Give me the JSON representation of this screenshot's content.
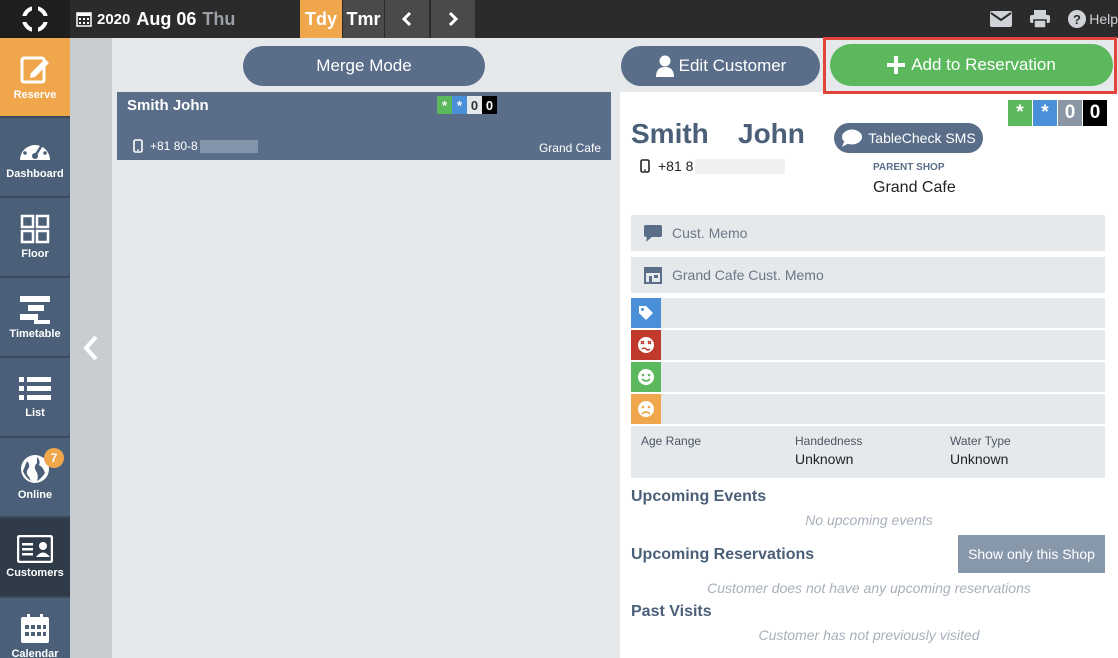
{
  "header": {
    "year": "2020",
    "month_day": "Aug 06",
    "weekday": "Thu",
    "today_label": "Tdy",
    "tomorrow_label": "Tmr",
    "help_label": "Help"
  },
  "sidebar": {
    "items": [
      {
        "label": "Reserve",
        "icon": "edit-icon"
      },
      {
        "label": "Dashboard",
        "icon": "dashboard-icon"
      },
      {
        "label": "Floor",
        "icon": "floor-icon"
      },
      {
        "label": "Timetable",
        "icon": "timetable-icon"
      },
      {
        "label": "List",
        "icon": "list-icon"
      },
      {
        "label": "Online",
        "icon": "globe-icon",
        "badge": "7"
      },
      {
        "label": "Customers",
        "icon": "customer-card-icon"
      },
      {
        "label": "Calendar",
        "icon": "calendar-icon"
      }
    ]
  },
  "list_panel": {
    "merge_label": "Merge Mode",
    "customer": {
      "name": "Smith John",
      "phone_prefix": "+81 80-8",
      "shop": "Grand Cafe",
      "badges": [
        "*",
        "*",
        "0",
        "0"
      ]
    }
  },
  "detail": {
    "edit_label": "Edit Customer",
    "add_label": "Add to Reservation",
    "badges": [
      "*",
      "*",
      "0",
      "0"
    ],
    "last_name": "Smith",
    "first_name": "John",
    "sms_label": "TableCheck SMS",
    "phone_prefix": "+81 8",
    "parent_shop_label": "PARENT SHOP",
    "parent_shop_value": "Grand Cafe",
    "cust_memo": "Cust. Memo",
    "shop_memo": "Grand Cafe Cust. Memo",
    "attributes": {
      "age_label": "Age Range",
      "age_value": "",
      "hand_label": "Handedness",
      "hand_value": "Unknown",
      "water_label": "Water Type",
      "water_value": "Unknown"
    },
    "upcoming_events_title": "Upcoming Events",
    "upcoming_events_empty": "No upcoming events",
    "upcoming_res_title": "Upcoming Reservations",
    "show_only_shop_label": "Show only this Shop",
    "upcoming_res_empty": "Customer does not have any upcoming reservations",
    "past_visits_title": "Past Visits",
    "past_visits_empty": "Customer has not previously visited"
  },
  "colors": {
    "accent_orange": "#f0a64a",
    "slate": "#5a6e89",
    "green": "#5cb85c",
    "blue_badge": "#4a90d9",
    "red_tag": "#c0392b",
    "highlight_red": "#e0443a"
  }
}
